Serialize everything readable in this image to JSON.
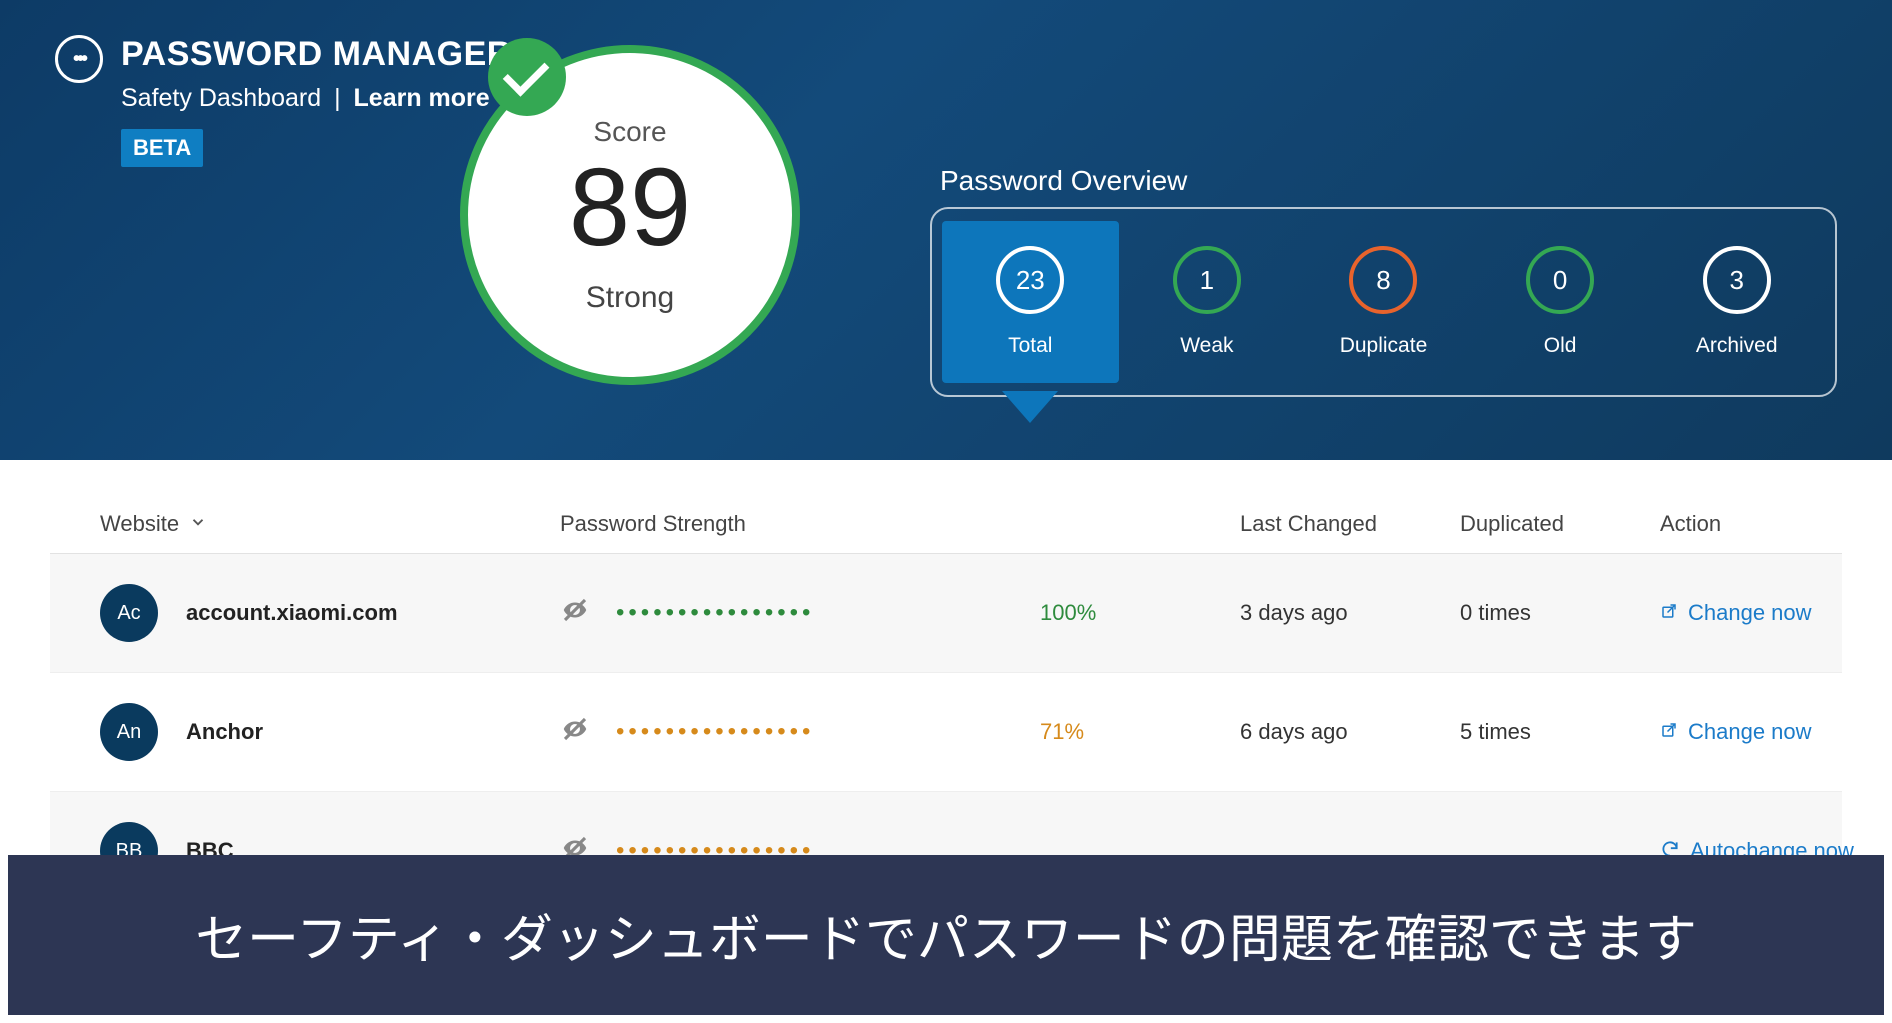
{
  "brand": {
    "title": "PASSWORD MANAGER",
    "subtitle": "Safety Dashboard",
    "learn_more": "Learn more",
    "beta": "BETA"
  },
  "score": {
    "label": "Score",
    "value": "89",
    "strength": "Strong"
  },
  "overview": {
    "title": "Password Overview",
    "items": [
      {
        "count": "23",
        "label": "Total",
        "color": "white",
        "active": true
      },
      {
        "count": "1",
        "label": "Weak",
        "color": "green",
        "active": false
      },
      {
        "count": "8",
        "label": "Duplicate",
        "color": "orange",
        "active": false
      },
      {
        "count": "0",
        "label": "Old",
        "color": "green",
        "active": false
      },
      {
        "count": "3",
        "label": "Archived",
        "color": "white",
        "active": false
      }
    ]
  },
  "table": {
    "headers": {
      "website": "Website",
      "strength": "Password Strength",
      "pct": "",
      "last_changed": "Last Changed",
      "duplicated": "Duplicated",
      "action": "Action"
    },
    "rows": [
      {
        "avatar": "Ac",
        "site": "account.xiaomi.com",
        "dots_color": "green",
        "pct": "100%",
        "pct_color": "green",
        "last_changed": "3 days ago",
        "duplicated": "0 times",
        "action": "Change now",
        "action_icon": "external"
      },
      {
        "avatar": "An",
        "site": "Anchor",
        "dots_color": "orange",
        "pct": "71%",
        "pct_color": "orange",
        "last_changed": "6 days ago",
        "duplicated": "5 times",
        "action": "Change now",
        "action_icon": "external"
      },
      {
        "avatar": "BB",
        "site": "BBC",
        "dots_color": "orange",
        "pct": "",
        "pct_color": "orange",
        "last_changed": "",
        "duplicated": "",
        "action": "Autochange now",
        "action_icon": "refresh"
      }
    ]
  },
  "caption": "セーフティ・ダッシュボードでパスワードの問題を確認できます"
}
